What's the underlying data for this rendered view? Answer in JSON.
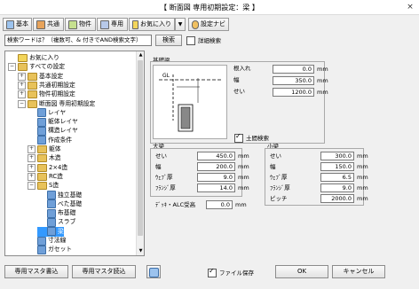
{
  "window": {
    "title": "【 断面図 専用初期設定：梁 】",
    "close": "×"
  },
  "toolbar": {
    "buttons": [
      {
        "label": "基本",
        "icon": "home-icon"
      },
      {
        "label": "共通",
        "icon": "common-icon"
      },
      {
        "label": "物件",
        "icon": "property-icon"
      },
      {
        "label": "専用",
        "icon": "dedicated-icon"
      },
      {
        "label": "お気に入り",
        "icon": "favorite-icon"
      },
      {
        "label": "▼",
        "icon": ""
      },
      {
        "label": "設定ナビ",
        "icon": "navi-icon"
      }
    ]
  },
  "search": {
    "value": "検索ワードは？（複数可、& 付きでAND検索文字）",
    "button": "検索",
    "detail_label": "詳細検索"
  },
  "tree": {
    "items": [
      {
        "label": "お気に入り",
        "level": 0,
        "exp": "",
        "kind": "fav"
      },
      {
        "label": "すべての設定",
        "level": 0,
        "exp": "−",
        "kind": "fold"
      },
      {
        "label": "基本設定",
        "level": 1,
        "exp": "+",
        "kind": "fold"
      },
      {
        "label": "共通初期設定",
        "level": 1,
        "exp": "+",
        "kind": "fold"
      },
      {
        "label": "物件初期設定",
        "level": 1,
        "exp": "+",
        "kind": "fold"
      },
      {
        "label": "断面図 専用初期設定",
        "level": 1,
        "exp": "−",
        "kind": "fold"
      },
      {
        "label": "レイヤ",
        "level": 2,
        "exp": "",
        "kind": "leaf"
      },
      {
        "label": "躯体レイヤ",
        "level": 2,
        "exp": "",
        "kind": "leaf"
      },
      {
        "label": "構造レイヤ",
        "level": 2,
        "exp": "",
        "kind": "leaf"
      },
      {
        "label": "作成条件",
        "level": 2,
        "exp": "",
        "kind": "leaf"
      },
      {
        "label": "躯体",
        "level": 2,
        "exp": "+",
        "kind": "fold"
      },
      {
        "label": "木造",
        "level": 2,
        "exp": "+",
        "kind": "fold"
      },
      {
        "label": "2×4造",
        "level": 2,
        "exp": "+",
        "kind": "fold"
      },
      {
        "label": "RC造",
        "level": 2,
        "exp": "+",
        "kind": "fold"
      },
      {
        "label": "S造",
        "level": 2,
        "exp": "−",
        "kind": "fold"
      },
      {
        "label": "独立基礎",
        "level": 3,
        "exp": "",
        "kind": "leaf"
      },
      {
        "label": "べた基礎",
        "level": 3,
        "exp": "",
        "kind": "leaf"
      },
      {
        "label": "布基礎",
        "level": 3,
        "exp": "",
        "kind": "leaf"
      },
      {
        "label": "スラブ",
        "level": 3,
        "exp": "",
        "kind": "leaf"
      },
      {
        "label": "梁",
        "level": 3,
        "exp": "",
        "kind": "leaf",
        "selected": true
      },
      {
        "label": "寸法線",
        "level": 2,
        "exp": "",
        "kind": "leaf"
      },
      {
        "label": "ガセット",
        "level": 2,
        "exp": "",
        "kind": "leaf"
      }
    ]
  },
  "kiso": {
    "group_label": "基礎梁",
    "gl_label": "GL",
    "rows": [
      {
        "label": "根入れ",
        "value": "0.0",
        "unit": "mm"
      },
      {
        "label": "幅",
        "value": "350.0",
        "unit": "mm"
      },
      {
        "label": "せい",
        "value": "1200.0",
        "unit": "mm"
      }
    ],
    "dodoma_label": "土間検索",
    "dodoma_checked": true
  },
  "obari": {
    "group_label": "大梁",
    "rows": [
      {
        "label": "せい",
        "value": "450.0",
        "unit": "mm"
      },
      {
        "label": "幅",
        "value": "200.0",
        "unit": "mm"
      },
      {
        "label": "ｳｪﾌﾞ厚",
        "value": "9.0",
        "unit": "mm"
      },
      {
        "label": "ﾌﾗﾝｼﾞ厚",
        "value": "14.0",
        "unit": "mm"
      }
    ]
  },
  "kobari": {
    "group_label": "小梁",
    "rows": [
      {
        "label": "せい",
        "value": "300.0",
        "unit": "mm"
      },
      {
        "label": "幅",
        "value": "150.0",
        "unit": "mm"
      },
      {
        "label": "ｳｪﾌﾞ厚",
        "value": "6.5",
        "unit": "mm"
      },
      {
        "label": "ﾌﾗﾝｼﾞ厚",
        "value": "9.0",
        "unit": "mm"
      },
      {
        "label": "ピッチ",
        "value": "2000.0",
        "unit": "mm"
      }
    ]
  },
  "deck": {
    "label": "ﾃﾞｯｷ・ALC受高",
    "value": "0.0",
    "unit": "mm"
  },
  "footer": {
    "master_write": "専用マスタ書込",
    "master_read": "専用マスタ読込",
    "file_save_label": "ファイル保存",
    "file_save_checked": true,
    "ok": "OK",
    "cancel": "キャンセル"
  }
}
